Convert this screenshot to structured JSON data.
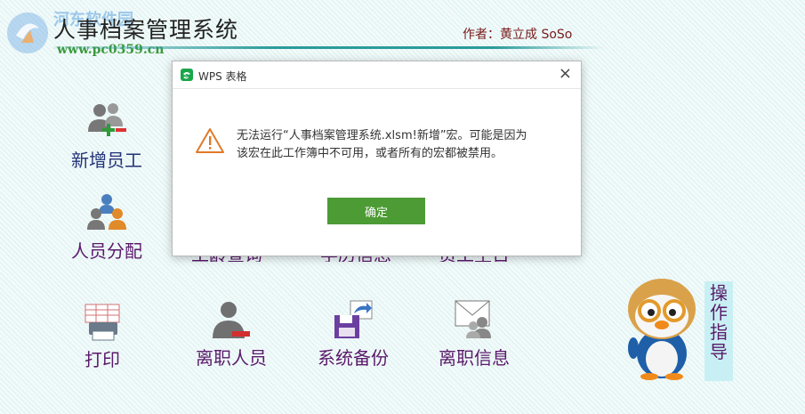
{
  "header": {
    "app_title": "人事档案管理系统",
    "author": "作者：黄立成 SoSo",
    "watermark_text": "河东软件园",
    "watermark_url": "www.pc0359.cn"
  },
  "tiles": {
    "add_employee": "新增员工",
    "staff_assign": "人员分配",
    "seniority_query": "工龄查询",
    "education_info": "学历信息",
    "employee_birthday": "员工生日",
    "print": "打印",
    "resigned_staff": "离职人员",
    "system_backup": "系统备份",
    "resign_info": "离职信息"
  },
  "guide_label": "操作指导",
  "dialog": {
    "title": "WPS 表格",
    "message_line1": "无法运行“人事档案管理系统.xlsm!新增”宏。可能是因为",
    "message_line2": "该宏在此工作簿中不可用，或者所有的宏都被禁用。",
    "ok_label": "确定",
    "close_glyph": "×"
  },
  "colors": {
    "ok_button": "#4c9b34",
    "tile_text": "#5a1a6a",
    "author_text": "#7a1a1a",
    "wps_green": "#1aa64a"
  }
}
